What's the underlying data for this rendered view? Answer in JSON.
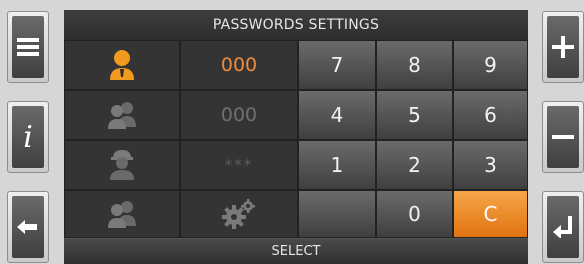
{
  "title": "PASSWORDS SETTINGS",
  "select_label": "SELECT",
  "users": [
    {
      "icon": "user-active-icon",
      "password": "000",
      "state": "active"
    },
    {
      "icon": "users-group-icon",
      "password": "000",
      "state": "inactive"
    },
    {
      "icon": "worker-helmet-icon",
      "password": "***",
      "state": "inactive"
    },
    {
      "icon": "users-group-icon",
      "password": "",
      "state": "inactive",
      "value_icon": "gears-icon"
    }
  ],
  "keypad": {
    "row1": [
      "7",
      "8",
      "9"
    ],
    "row2": [
      "4",
      "5",
      "6"
    ],
    "row3": [
      "1",
      "2",
      "3"
    ],
    "row4": [
      "",
      "0",
      "C"
    ]
  },
  "left_buttons": [
    "menu-icon",
    "info-icon",
    "back-arrow-icon"
  ],
  "right_buttons": [
    "plus-icon",
    "minus-icon",
    "enter-icon"
  ],
  "info_glyph": "i",
  "colors": {
    "accent": "#f08a3c",
    "key_top": "#6b6b6b",
    "key_bottom": "#3f3f3f",
    "clear_key": "#e0730f"
  }
}
